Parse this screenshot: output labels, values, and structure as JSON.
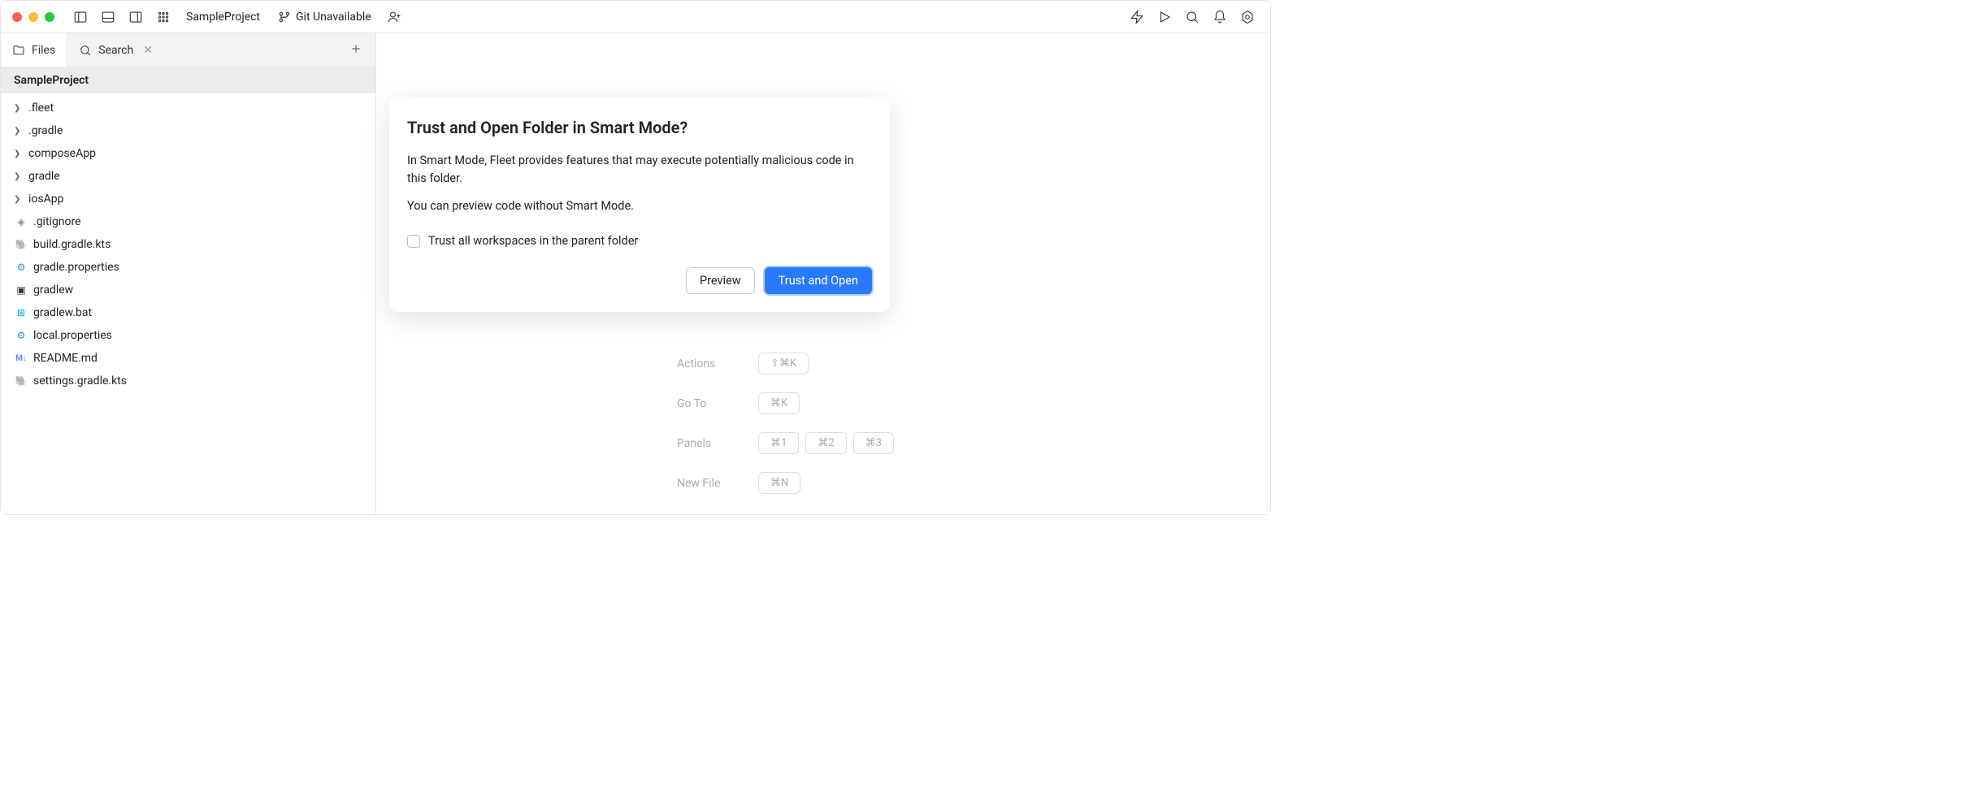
{
  "toolbar": {
    "project_name": "SampleProject",
    "git_status": "Git Unavailable"
  },
  "sidebar": {
    "tabs": {
      "files": "Files",
      "search": "Search"
    },
    "project_name": "SampleProject",
    "tree": [
      {
        "name": ".fleet",
        "type": "folder"
      },
      {
        "name": ".gradle",
        "type": "folder"
      },
      {
        "name": "composeApp",
        "type": "folder"
      },
      {
        "name": "gradle",
        "type": "folder"
      },
      {
        "name": "iosApp",
        "type": "folder"
      },
      {
        "name": ".gitignore",
        "type": "git"
      },
      {
        "name": "build.gradle.kts",
        "type": "gradle"
      },
      {
        "name": "gradle.properties",
        "type": "settings"
      },
      {
        "name": "gradlew",
        "type": "terminal"
      },
      {
        "name": "gradlew.bat",
        "type": "windows"
      },
      {
        "name": "local.properties",
        "type": "settings"
      },
      {
        "name": "README.md",
        "type": "md"
      },
      {
        "name": "settings.gradle.kts",
        "type": "gradle"
      }
    ]
  },
  "modal": {
    "title": "Trust and Open Folder in Smart Mode?",
    "text1": "In Smart Mode, Fleet provides features that may execute potentially malicious code in this folder.",
    "text2": "You can preview code without Smart Mode.",
    "checkbox_label": "Trust all workspaces in the parent folder",
    "preview_btn": "Preview",
    "trust_btn": "Trust and Open"
  },
  "shortcuts": {
    "actions": {
      "label": "Actions",
      "keys": [
        "⇧⌘K"
      ]
    },
    "goto": {
      "label": "Go To",
      "keys": [
        "⌘K"
      ]
    },
    "panels": {
      "label": "Panels",
      "keys": [
        "⌘1",
        "⌘2",
        "⌘3"
      ]
    },
    "newfile": {
      "label": "New File",
      "keys": [
        "⌘N"
      ]
    }
  }
}
